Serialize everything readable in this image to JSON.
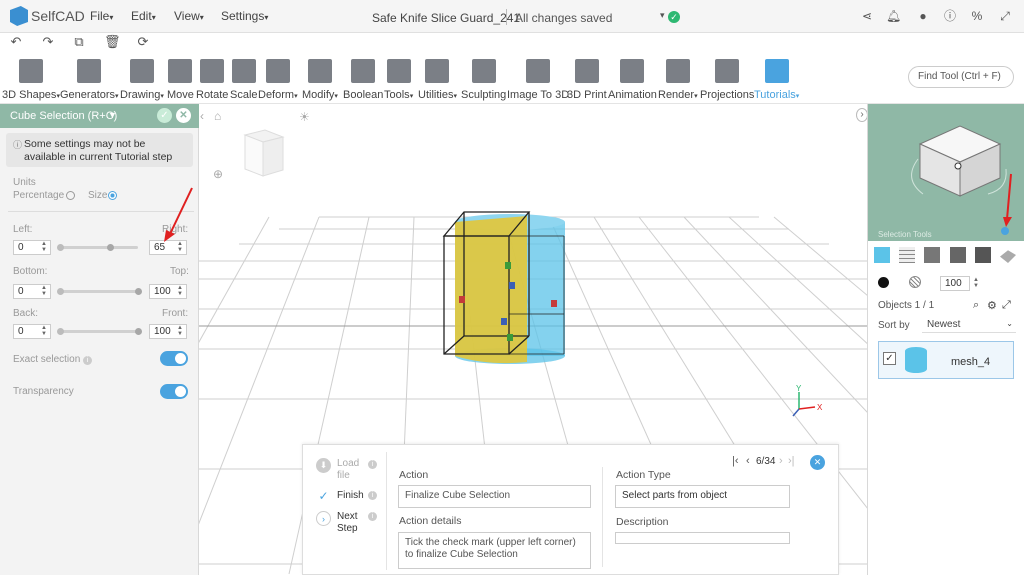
{
  "app": {
    "name": "SelfCAD"
  },
  "menu": [
    {
      "label": "File"
    },
    {
      "label": "Edit"
    },
    {
      "label": "View"
    },
    {
      "label": "Settings"
    }
  ],
  "document": {
    "title": "Safe Knife Slice Guard_241",
    "status": "All changes saved"
  },
  "toolbar": {
    "tools": [
      {
        "label": "3D Shapes",
        "dropdown": true
      },
      {
        "label": "Generators",
        "dropdown": true
      },
      {
        "label": "Drawing",
        "dropdown": true
      },
      {
        "label": "Move"
      },
      {
        "label": "Rotate"
      },
      {
        "label": "Scale"
      },
      {
        "label": "Deform",
        "dropdown": true
      },
      {
        "label": "Modify",
        "dropdown": true
      },
      {
        "label": "Boolean"
      },
      {
        "label": "Tools",
        "dropdown": true
      },
      {
        "label": "Utilities",
        "dropdown": true
      },
      {
        "label": "Sculpting"
      },
      {
        "label": "Image To 3D"
      },
      {
        "label": "3D Print"
      },
      {
        "label": "Animation"
      },
      {
        "label": "Render",
        "dropdown": true
      },
      {
        "label": "Projections"
      },
      {
        "label": "Tutorials",
        "dropdown": true
      }
    ],
    "find_placeholder": "Find Tool (Ctrl + F)"
  },
  "left_panel": {
    "title": "Cube Selection (R+C)",
    "notice": "Some settings may not be available in current Tutorial step",
    "units_label": "Units",
    "unit_percentage": "Percentage",
    "unit_size": "Size",
    "left_label": "Left:",
    "right_label": "Right:",
    "left_value": "0",
    "right_value": "65",
    "bottom_label": "Bottom:",
    "top_label": "Top:",
    "bottom_value": "0",
    "top_value": "100",
    "back_label": "Back:",
    "front_label": "Front:",
    "back_value": "0",
    "front_value": "100",
    "exact_selection_label": "Exact selection",
    "exact_selection_on": true,
    "transparency_label": "Transparency",
    "transparency_on": true
  },
  "right_panel": {
    "cube_view_label": "Selection Tools",
    "opacity_value": "100",
    "objects_label": "Objects 1 / 1",
    "sort_by_label": "Sort by",
    "sort_by_value": "Newest",
    "object_name": "mesh_4"
  },
  "tutorial": {
    "steps": [
      {
        "label": "Load file"
      },
      {
        "label": "Finish"
      },
      {
        "label": "Next Step"
      }
    ],
    "pagination": "6/34",
    "action_label": "Action",
    "action_value": "Finalize Cube Selection",
    "action_type_label": "Action Type",
    "action_type_value": "Select parts from object",
    "action_details_label": "Action details",
    "action_details_value": "Tick the check mark (upper left corner) to finalize Cube Selection",
    "description_label": "Description",
    "description_value": ""
  },
  "colors": {
    "accent": "#4aa3df",
    "panel_header": "#8fb8a6",
    "success": "#2eb872",
    "cylinder": "#5bc3e8",
    "selection": "#e3c637"
  }
}
